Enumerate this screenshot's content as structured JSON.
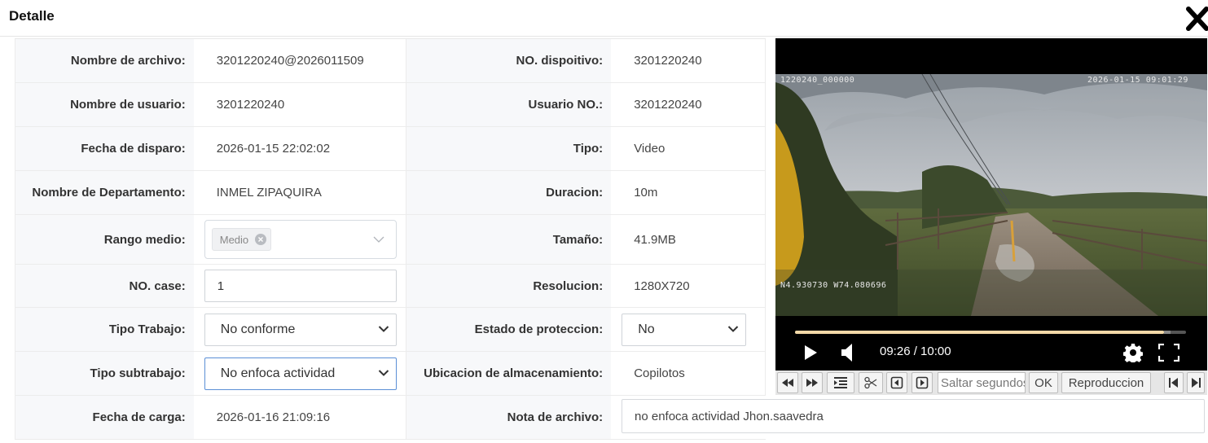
{
  "header": {
    "title": "Detalle"
  },
  "fields": {
    "nombre_archivo": {
      "label": "Nombre de archivo:",
      "value": "3201220240@2026011509"
    },
    "no_dispositivo": {
      "label": "NO. dispoitivo:",
      "value": "3201220240"
    },
    "nombre_usuario": {
      "label": "Nombre de usuario:",
      "value": "3201220240"
    },
    "usuario_no": {
      "label": "Usuario NO.:",
      "value": "3201220240"
    },
    "fecha_disparo": {
      "label": "Fecha de disparo:",
      "value": "2026-01-15 22:02:02"
    },
    "tipo": {
      "label": "Tipo:",
      "value": "Video"
    },
    "departamento": {
      "label": "Nombre de Departamento:",
      "value": "INMEL ZIPAQUIRA"
    },
    "duracion": {
      "label": "Duracion:",
      "value": "10m"
    },
    "rango_medio": {
      "label": "Rango medio:",
      "tag": "Medio"
    },
    "tamano": {
      "label": "Tamaño:",
      "value": "41.9MB"
    },
    "no_case": {
      "label": "NO. case:",
      "value": "1"
    },
    "resolucion": {
      "label": "Resolucion:",
      "value": "1280X720"
    },
    "tipo_trabajo": {
      "label": "Tipo Trabajo:",
      "value": "No conforme"
    },
    "estado_proteccion": {
      "label": "Estado de proteccion:",
      "value": "No"
    },
    "tipo_subtrabajo": {
      "label": "Tipo subtrabajo:",
      "value": "No enfoca actividad"
    },
    "ubicacion": {
      "label": "Ubicacion de almacenamiento:",
      "value": "Copilotos"
    },
    "fecha_carga": {
      "label": "Fecha de carga:",
      "value": "2026-01-16 21:09:16"
    },
    "nota": {
      "label": "Nota de archivo:",
      "value": "no enfoca actividad Jhon.saavedra"
    }
  },
  "player": {
    "osd_device": "1220240_000000",
    "osd_datetime": "2026-01-15 09:01:29",
    "osd_gps": "N4.930730  W74.080696",
    "time": "09:26 / 10:00",
    "progress": 0.943,
    "buffered": 0.96
  },
  "toolbar": {
    "seek_placeholder": "Saltar segundos",
    "ok_label": "OK",
    "playback_label": "Reproduccion"
  },
  "colors": {
    "progress_fill": "#f3d9a8",
    "focus_border": "#5b8fd6"
  }
}
